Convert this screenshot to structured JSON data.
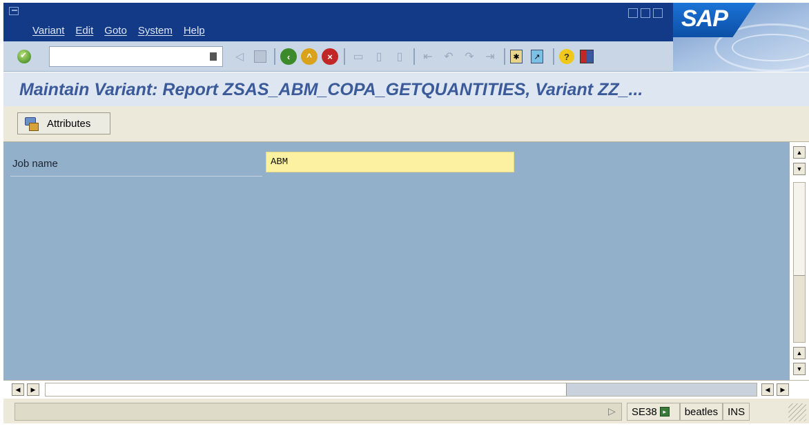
{
  "window": {
    "menu": [
      "Variant",
      "Edit",
      "Goto",
      "System",
      "Help"
    ],
    "brand": "SAP"
  },
  "toolbar": {
    "command_value": "",
    "icons": [
      "enter-icon",
      "command-history-icon",
      "back-arrow-icon",
      "save-icon",
      "back-icon",
      "exit-icon",
      "cancel-icon",
      "print-icon",
      "find-icon",
      "find-next-icon",
      "first-page-icon",
      "previous-page-icon",
      "next-page-icon",
      "last-page-icon",
      "create-session-icon",
      "shortcut-icon",
      "help-icon",
      "customize-layout-icon"
    ]
  },
  "title": "Maintain Variant: Report ZSAS_ABM_COPA_GETQUANTITIES, Variant ZZ_...",
  "app_toolbar": {
    "attributes_label": "Attributes"
  },
  "form": {
    "job_name_label": "Job name",
    "job_name_value": "ABM"
  },
  "status": {
    "message": "",
    "transaction": "SE38",
    "server": "beatles",
    "mode": "INS"
  },
  "colors": {
    "menubar": "#133a87",
    "title_text": "#3b5a9a",
    "main_bg": "#92b0c9",
    "input_required": "#fbf1a0"
  }
}
